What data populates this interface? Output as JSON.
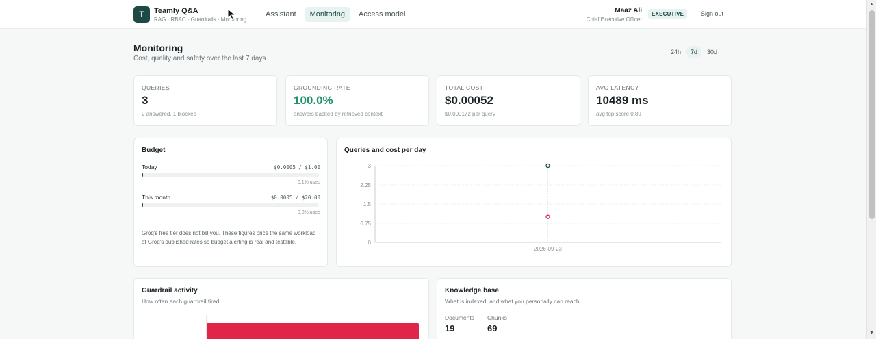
{
  "app": {
    "logo_letter": "T",
    "name": "Teamly Q&A",
    "tagline": "RAG · RBAC · Guardrails · Monitoring"
  },
  "nav": {
    "tabs": [
      "Assistant",
      "Monitoring",
      "Access model"
    ],
    "active": "Monitoring"
  },
  "user": {
    "name": "Maaz Ali",
    "role": "Chief Executive Officer",
    "badge": "EXECUTIVE",
    "signout_label": "Sign out"
  },
  "page": {
    "title": "Monitoring",
    "subtitle": "Cost, quality and safety over the last 7 days.",
    "ranges": [
      "24h",
      "7d",
      "30d"
    ],
    "active_range": "7d"
  },
  "kpis": [
    {
      "label": "QUERIES",
      "value": "3",
      "sub": "2 answered, 1 blocked",
      "accent": false
    },
    {
      "label": "GROUNDING RATE",
      "value": "100.0%",
      "sub": "answers backed by retrieved context",
      "accent": true
    },
    {
      "label": "TOTAL COST",
      "value": "$0.00052",
      "sub": "$0.000172 per query",
      "accent": false
    },
    {
      "label": "AVG LATENCY",
      "value": "10489 ms",
      "sub": "avg top score 0.89",
      "accent": false
    }
  ],
  "budget": {
    "title": "Budget",
    "rows": [
      {
        "label": "Today",
        "amount": "$0.0005 / $1.00",
        "used_label": "0.1% used",
        "fraction": 0.001
      },
      {
        "label": "This month",
        "amount": "$0.0005 / $20.00",
        "used_label": "0.0% used",
        "fraction": 0.0
      }
    ],
    "note": "Groq's free tier does not bill you. These figures price the same workload at Groq's published rates so budget alerting is real and testable."
  },
  "chart": {
    "title": "Queries and cost per day"
  },
  "chart_data": {
    "type": "scatter",
    "title": "Queries and cost per day",
    "x": [
      "2026-09-23"
    ],
    "yticks": [
      "0",
      "0.75",
      "1.5",
      "2.25",
      "3"
    ],
    "ylim": [
      0,
      3
    ],
    "series": [
      {
        "values": [
          3
        ],
        "color": "#1d4a44"
      },
      {
        "values": [
          1
        ],
        "color": "#e0244a"
      }
    ],
    "grid": true
  },
  "guardrail": {
    "title": "Guardrail activity",
    "subtitle": "How often each guardrail fired.",
    "bar_color": "#e0244a"
  },
  "knowledge": {
    "title": "Knowledge base",
    "subtitle": "What is indexed, and what you personally can reach.",
    "stats": [
      {
        "label": "Documents",
        "value": "19"
      },
      {
        "label": "Chunks",
        "value": "69"
      }
    ]
  }
}
